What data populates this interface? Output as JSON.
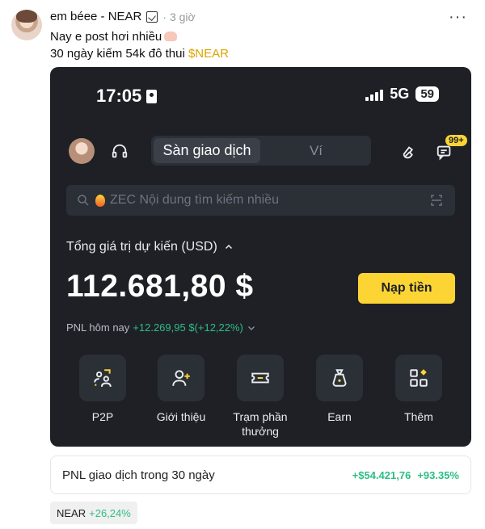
{
  "post": {
    "username": "em béee - NEAR",
    "time": "· 3 giờ",
    "line1": "Nay e post hơi nhiều",
    "line2_prefix": "30 ngày kiếm 54k đô thui ",
    "line2_ticker": "$NEAR"
  },
  "phone": {
    "status": {
      "time": "17:05",
      "network": "5G",
      "battery": "59"
    },
    "tabs": {
      "active": "Sàn giao dịch",
      "inactive": "Ví"
    },
    "notif_count": "99+",
    "search_placeholder": "ZEC Nội dung tìm kiếm nhiều",
    "total_label": "Tổng giá trị dự kiến (USD)",
    "balance": "112.681,80 $",
    "deposit_label": "Nạp tiền",
    "pnl_label": "PNL hôm nay",
    "pnl_value": "+12.269,95 $(+12,22%)",
    "actions": [
      {
        "label": "P2P",
        "icon": "p2p-icon"
      },
      {
        "label": "Giới thiệu",
        "icon": "add-user-icon"
      },
      {
        "label": "Trạm phần thưởng",
        "icon": "ticket-icon"
      },
      {
        "label": "Earn",
        "icon": "moneybag-icon"
      },
      {
        "label": "Thêm",
        "icon": "grid-icon"
      }
    ]
  },
  "pnl_card": {
    "label": "PNL giao dịch trong 30 ngày",
    "amount": "+$54.421,76",
    "percent": "+93.35%"
  },
  "tag": {
    "name": "NEAR",
    "change": "+26,24%"
  },
  "colors": {
    "accent_yellow": "#fcd535",
    "positive_green": "#2ebd85",
    "phone_bg": "#1e2026",
    "ticker": "#d9a400"
  }
}
